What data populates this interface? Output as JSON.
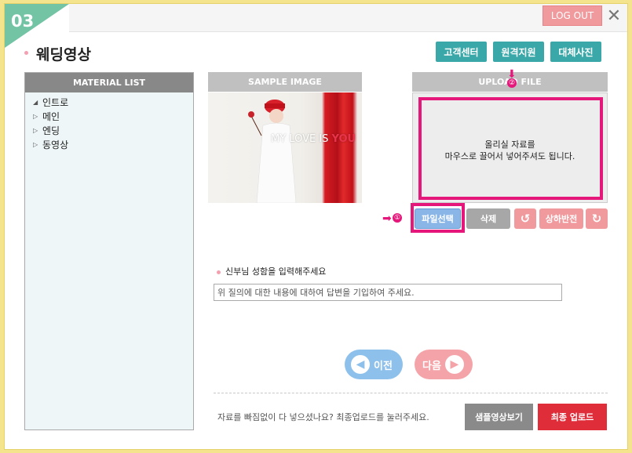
{
  "step": {
    "number": "03"
  },
  "topbar": {
    "logout_label": "LOG OUT",
    "close_symbol": "✕"
  },
  "page": {
    "title": "웨딩영상"
  },
  "header_buttons": [
    {
      "label": "고객센터"
    },
    {
      "label": "원격지원"
    },
    {
      "label": "대체사진"
    }
  ],
  "material_list": {
    "header": "MATERIAL LIST",
    "items": [
      {
        "label": "인트로",
        "state": "expanded"
      },
      {
        "label": "메인",
        "state": "collapsed"
      },
      {
        "label": "엔딩",
        "state": "collapsed"
      },
      {
        "label": "동영상",
        "state": "collapsed"
      }
    ]
  },
  "sample": {
    "header": "SAMPLE IMAGE",
    "overlay_text": "MY LOVE IS",
    "overlay_accent": "YOU"
  },
  "upload": {
    "header": "UPLOAD FILE",
    "instructions_line1": "올리실 자료를",
    "instructions_line2": "마우스로 끌어서 넣어주셔도 됩니다.",
    "marker": "②"
  },
  "file_actions": {
    "marker": "①",
    "file_select": "파일선택",
    "delete": "삭제",
    "rotate_left_icon": "↺",
    "flip_vertical": "상하반전",
    "rotate_right_icon": "↻"
  },
  "question": {
    "label": "신부님 성함을 입력해주세요",
    "answer_value": "위 질의에 대한 내용에 대하여 답변을 기입하여 주세요."
  },
  "navigation": {
    "prev_label": "이전",
    "next_label": "다음"
  },
  "footer": {
    "message": "자료를 빠짐없이 다 넣으셨나요? 최종업로드를 눌러주세요.",
    "sample_video_label": "샘플영상보기",
    "final_upload_label": "최종 업로드"
  },
  "colors": {
    "teal_accent": "#3aa8a9",
    "pink_highlight": "#e5177a",
    "final_red": "#e02d3a"
  }
}
